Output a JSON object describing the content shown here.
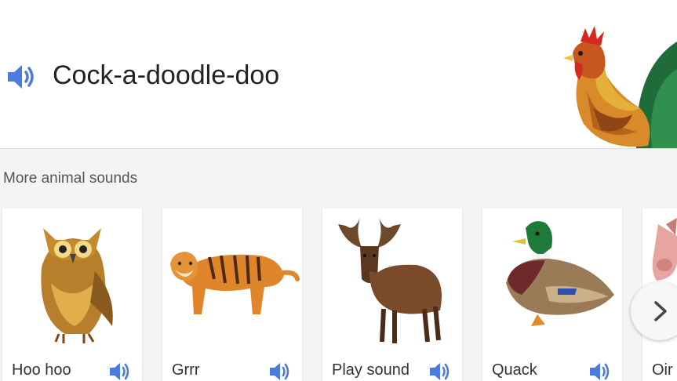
{
  "hero": {
    "title": "Cock-a-doodle-doo",
    "speaker_icon": "speaker-icon",
    "image": "rooster-illustration"
  },
  "more": {
    "title": "More animal sounds",
    "cards": [
      {
        "label": "Hoo hoo",
        "image": "owl-illustration"
      },
      {
        "label": "Grrr",
        "image": "tiger-illustration"
      },
      {
        "label": "Play sound",
        "image": "moose-illustration"
      },
      {
        "label": "Quack",
        "image": "duck-illustration"
      },
      {
        "label": "Oir",
        "image": "pig-illustration"
      }
    ],
    "next_icon": "chevron-right-icon"
  },
  "colors": {
    "speaker": "#4a7be0",
    "background": "#f4f4f4",
    "card": "#ffffff"
  }
}
